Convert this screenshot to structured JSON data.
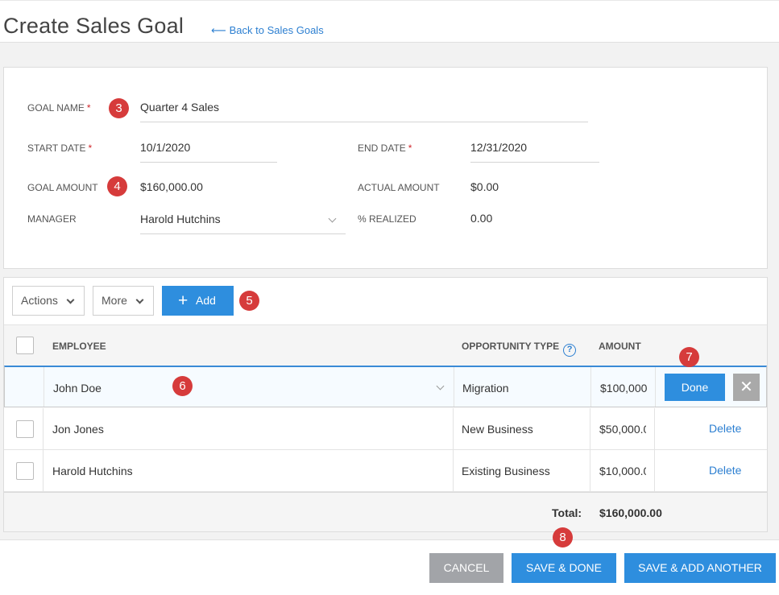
{
  "header": {
    "title": "Create Sales Goal",
    "back_arrow": "⟵",
    "back_label": "Back to Sales Goals"
  },
  "form": {
    "goal_name": {
      "label": "GOAL NAME",
      "required": "*",
      "value": "Quarter 4 Sales"
    },
    "start_date": {
      "label": "START DATE",
      "required": "*",
      "value": "10/1/2020"
    },
    "end_date": {
      "label": "END DATE",
      "required": "*",
      "value": "12/31/2020"
    },
    "goal_amount": {
      "label": "GOAL AMOUNT",
      "value": "$160,000.00"
    },
    "actual_amount": {
      "label": "ACTUAL AMOUNT",
      "value": "$0.00"
    },
    "manager": {
      "label": "MANAGER",
      "value": "Harold Hutchins"
    },
    "percent_realized": {
      "label": "% REALIZED",
      "value": "0.00"
    }
  },
  "toolbar": {
    "actions_label": "Actions",
    "more_label": "More",
    "add_icon": "+",
    "add_label": "Add"
  },
  "table": {
    "columns": {
      "employee": "EMPLOYEE",
      "opportunity_type": "OPPORTUNITY TYPE",
      "help_glyph": "?",
      "amount": "AMOUNT"
    },
    "rows": [
      {
        "employee": "John Doe",
        "opportunity_type": "Migration",
        "amount": "$100,000"
      },
      {
        "employee": "Jon Jones",
        "opportunity_type": "New Business",
        "amount": "$50,000.0",
        "action": "Delete"
      },
      {
        "employee": "Harold Hutchins",
        "opportunity_type": "Existing Business",
        "amount": "$10,000.0",
        "action": "Delete"
      }
    ],
    "done_label": "Done",
    "close_glyph": "✕",
    "total_label": "Total:",
    "total_value": "$160,000.00"
  },
  "footer": {
    "cancel_label": "CANCEL",
    "save_done_label": "SAVE & DONE",
    "save_add_label": "SAVE & ADD ANOTHER"
  },
  "callouts": [
    "3",
    "4",
    "5",
    "6",
    "7",
    "8"
  ],
  "colors": {
    "accent": "#2e8ede",
    "link": "#2c7fd1",
    "required": "#d0262b",
    "callout": "#d63b3b",
    "cancel": "#a2a4a8"
  }
}
